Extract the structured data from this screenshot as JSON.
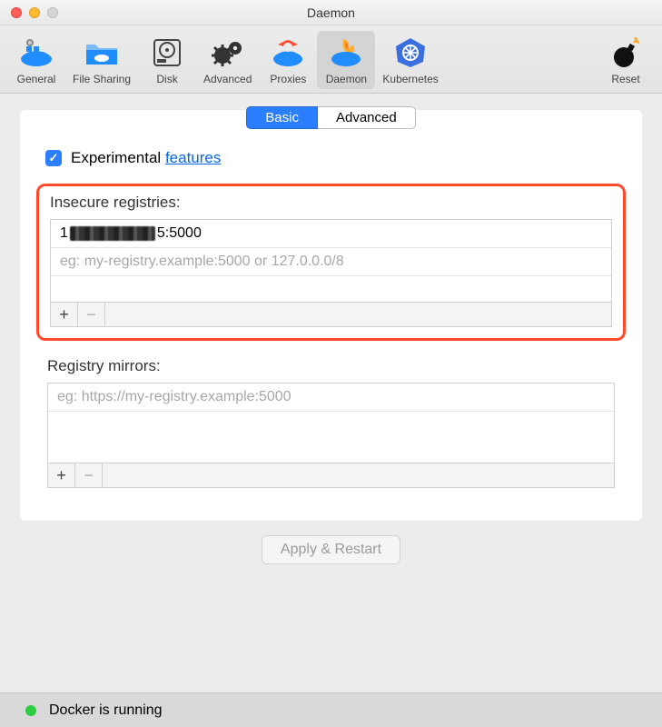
{
  "window": {
    "title": "Daemon"
  },
  "toolbar": {
    "items": [
      {
        "label": "General"
      },
      {
        "label": "File Sharing"
      },
      {
        "label": "Disk"
      },
      {
        "label": "Advanced"
      },
      {
        "label": "Proxies"
      },
      {
        "label": "Daemon"
      },
      {
        "label": "Kubernetes"
      }
    ],
    "reset": {
      "label": "Reset"
    },
    "active_index": 5
  },
  "tabs": {
    "basic": "Basic",
    "advanced": "Advanced",
    "active": "basic"
  },
  "experimental": {
    "checked": true,
    "label_prefix": "Experimental ",
    "link_text": "features"
  },
  "insecure": {
    "label": "Insecure registries:",
    "entry_prefix": "1",
    "entry_suffix": "5:5000",
    "placeholder": "eg: my-registry.example:5000 or 127.0.0.0/8",
    "add": "+",
    "remove": "−"
  },
  "mirrors": {
    "label": "Registry mirrors:",
    "placeholder": "eg: https://my-registry.example:5000",
    "add": "+",
    "remove": "−"
  },
  "apply": {
    "label": "Apply & Restart"
  },
  "status": {
    "text": "Docker is running",
    "color": "#2ecc40"
  }
}
